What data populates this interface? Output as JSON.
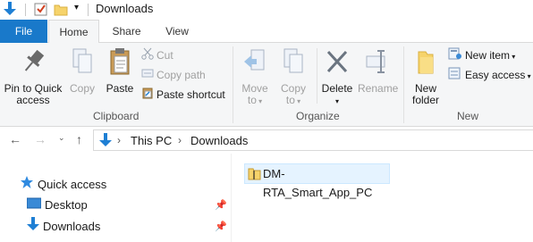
{
  "window": {
    "title": "Downloads"
  },
  "tabs": {
    "file": "File",
    "home": "Home",
    "share": "Share",
    "view": "View"
  },
  "ribbon": {
    "clipboard": {
      "label": "Clipboard",
      "pin": "Pin to Quick access",
      "pin_line1": "Pin to Quick",
      "pin_line2": "access",
      "copy": "Copy",
      "paste": "Paste",
      "cut": "Cut",
      "copy_path": "Copy path",
      "paste_shortcut": "Paste shortcut"
    },
    "organize": {
      "label": "Organize",
      "move_to_line1": "Move",
      "move_to_line2": "to",
      "copy_to_line1": "Copy",
      "copy_to_line2": "to",
      "delete": "Delete",
      "rename": "Rename"
    },
    "new": {
      "label": "New",
      "new_folder_line1": "New",
      "new_folder_line2": "folder",
      "new_item": "New item",
      "easy_access": "Easy access"
    }
  },
  "address": {
    "crumbs": [
      "This PC",
      "Downloads"
    ]
  },
  "nav": {
    "items": [
      {
        "label": "Quick access"
      },
      {
        "label": "Desktop"
      },
      {
        "label": "Downloads"
      }
    ]
  },
  "files": [
    {
      "name": "DM-RTA_Smart_App_PC"
    }
  ],
  "colors": {
    "accent": "#1979ca",
    "selection": "#e5f3ff"
  }
}
